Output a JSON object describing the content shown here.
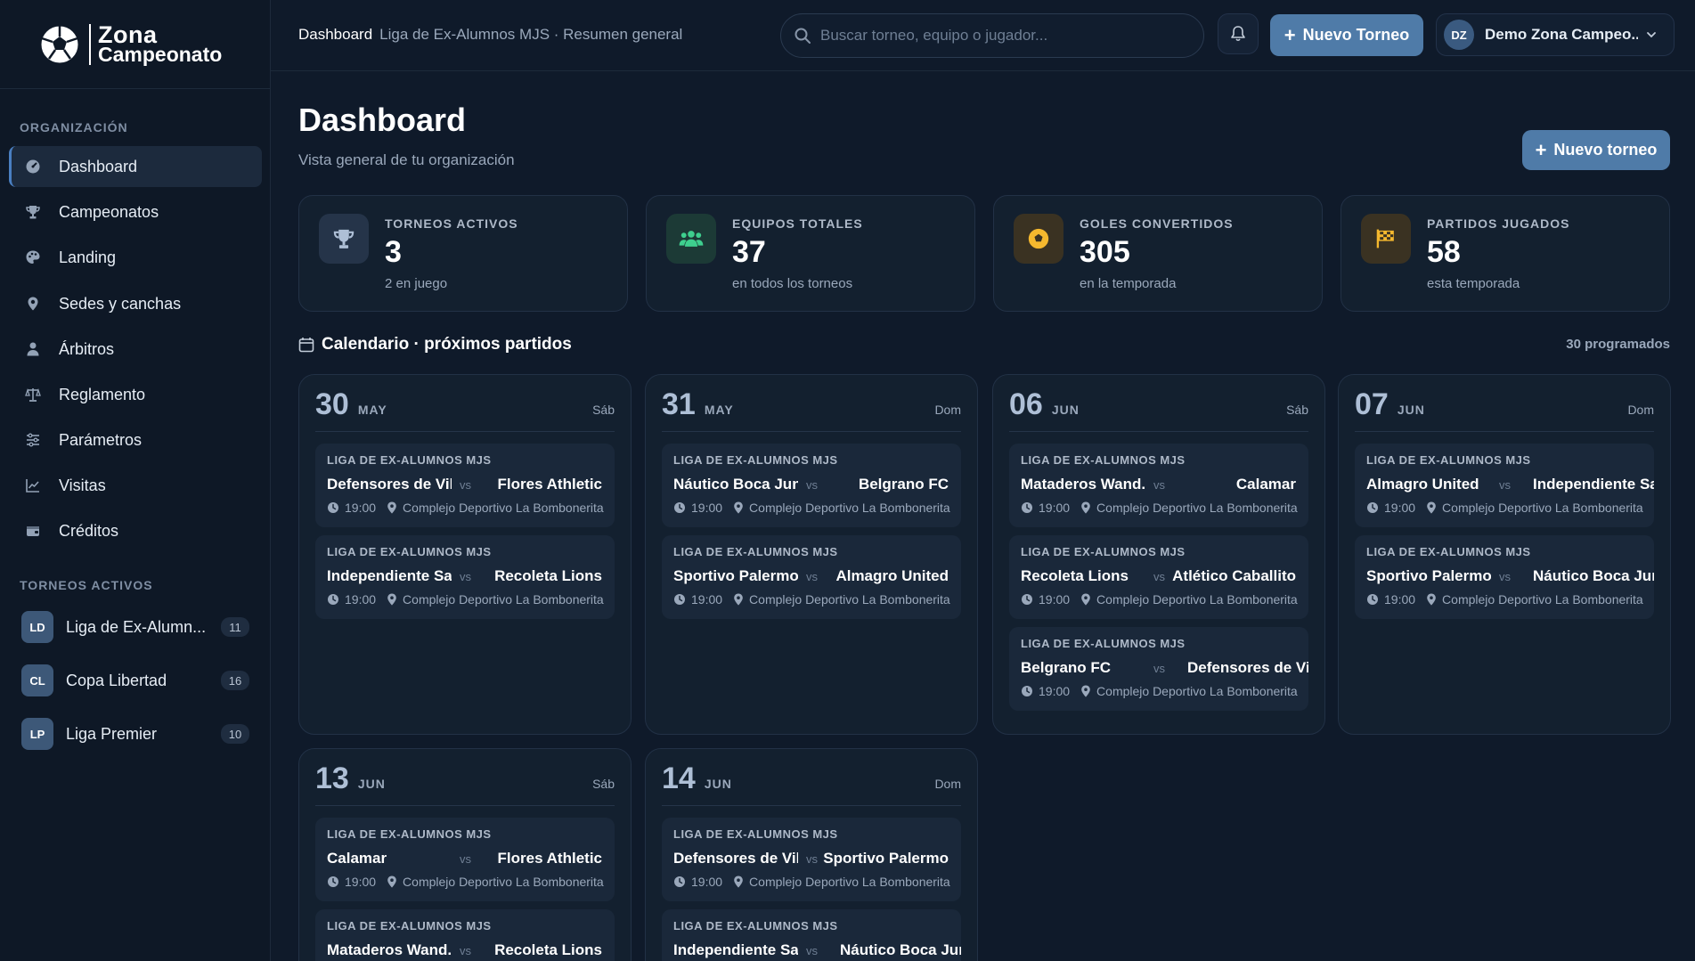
{
  "brand": {
    "line1": "Zona",
    "line2": "Campeonato"
  },
  "sidebar": {
    "org_section": "ORGANIZACIÓN",
    "items": [
      {
        "label": "Dashboard",
        "icon": "gauge-icon"
      },
      {
        "label": "Campeonatos",
        "icon": "trophy-icon"
      },
      {
        "label": "Landing",
        "icon": "palette-icon"
      },
      {
        "label": "Sedes y canchas",
        "icon": "map-pin-icon"
      },
      {
        "label": "Árbitros",
        "icon": "referee-icon"
      },
      {
        "label": "Reglamento",
        "icon": "scale-icon"
      },
      {
        "label": "Parámetros",
        "icon": "sliders-icon"
      },
      {
        "label": "Visitas",
        "icon": "chart-line-icon"
      },
      {
        "label": "Créditos",
        "icon": "wallet-icon"
      }
    ],
    "tournaments_section": "TORNEOS ACTIVOS",
    "tournaments": [
      {
        "initials": "LD",
        "name": "Liga de Ex-Alumn...",
        "count": "11"
      },
      {
        "initials": "CL",
        "name": "Copa Libertad",
        "count": "16"
      },
      {
        "initials": "LP",
        "name": "Liga Premier",
        "count": "10"
      }
    ]
  },
  "topbar": {
    "crumb_main": "Dashboard",
    "crumb_sub": "Liga de Ex-Alumnos MJS · Resumen general",
    "search_placeholder": "Buscar torneo, equipo o jugador...",
    "new_button": "Nuevo Torneo",
    "user_initials": "DZ",
    "user_name": "Demo Zona Campeo..."
  },
  "page": {
    "title": "Dashboard",
    "subtitle": "Vista general de tu organización",
    "new_button": "Nuevo torneo"
  },
  "stats": [
    {
      "label": "TORNEOS ACTIVOS",
      "value": "3",
      "sub": "2 en juego",
      "color": "#aebfd6",
      "bg": "#253449"
    },
    {
      "label": "EQUIPOS TOTALES",
      "value": "37",
      "sub": "en todos los torneos",
      "color": "#3ecf8e",
      "bg": "#1c3a36"
    },
    {
      "label": "GOLES CONVERTIDOS",
      "value": "305",
      "sub": "en la temporada",
      "color": "#f5b82e",
      "bg": "#3a3222"
    },
    {
      "label": "PARTIDOS JUGADOS",
      "value": "58",
      "sub": "esta temporada",
      "color": "#f5b82e",
      "bg": "#3a3222"
    }
  ],
  "calendar": {
    "title": "Calendario · próximos partidos",
    "count": "30 programados",
    "days": [
      {
        "num": "30",
        "month": "MAY",
        "dow": "Sáb",
        "matches": [
          {
            "league": "LIGA DE EX-ALUMNOS MJS",
            "home": "Defensores de Vil...",
            "vs": "vs",
            "away": "Flores Athletic",
            "time": "19:00",
            "venue": "Complejo Deportivo La Bombonerita"
          },
          {
            "league": "LIGA DE EX-ALUMNOS MJS",
            "home": "Independiente Sa...",
            "vs": "vs",
            "away": "Recoleta Lions",
            "time": "19:00",
            "venue": "Complejo Deportivo La Bombonerita"
          }
        ]
      },
      {
        "num": "31",
        "month": "MAY",
        "dow": "Dom",
        "matches": [
          {
            "league": "LIGA DE EX-ALUMNOS MJS",
            "home": "Náutico Boca Jun...",
            "vs": "vs",
            "away": "Belgrano FC",
            "time": "19:00",
            "venue": "Complejo Deportivo La Bombonerita"
          },
          {
            "league": "LIGA DE EX-ALUMNOS MJS",
            "home": "Sportivo Palermo",
            "vs": "vs",
            "away": "Almagro United",
            "time": "19:00",
            "venue": "Complejo Deportivo La Bombonerita"
          }
        ]
      },
      {
        "num": "06",
        "month": "JUN",
        "dow": "Sáb",
        "matches": [
          {
            "league": "LIGA DE EX-ALUMNOS MJS",
            "home": "Mataderos Wand...",
            "vs": "vs",
            "away": "Calamar",
            "time": "19:00",
            "venue": "Complejo Deportivo La Bombonerita"
          },
          {
            "league": "LIGA DE EX-ALUMNOS MJS",
            "home": "Recoleta Lions",
            "vs": "vs",
            "away": "Atlético Caballito",
            "time": "19:00",
            "venue": "Complejo Deportivo La Bombonerita"
          },
          {
            "league": "LIGA DE EX-ALUMNOS MJS",
            "home": "Belgrano FC",
            "vs": "vs",
            "away": "Defensores de Villa C",
            "time": "19:00",
            "venue": "Complejo Deportivo La Bombonerita"
          }
        ]
      },
      {
        "num": "07",
        "month": "JUN",
        "dow": "Dom",
        "matches": [
          {
            "league": "LIGA DE EX-ALUMNOS MJS",
            "home": "Almagro United",
            "vs": "vs",
            "away": "Independiente San Te",
            "time": "19:00",
            "venue": "Complejo Deportivo La Bombonerita"
          },
          {
            "league": "LIGA DE EX-ALUMNOS MJS",
            "home": "Sportivo Palermo",
            "vs": "vs",
            "away": "Náutico Boca Juniors",
            "time": "19:00",
            "venue": "Complejo Deportivo La Bombonerita"
          }
        ]
      },
      {
        "num": "13",
        "month": "JUN",
        "dow": "Sáb",
        "matches": [
          {
            "league": "LIGA DE EX-ALUMNOS MJS",
            "home": "Calamar",
            "vs": "vs",
            "away": "Flores Athletic",
            "time": "19:00",
            "venue": "Complejo Deportivo La Bombonerita"
          },
          {
            "league": "LIGA DE EX-ALUMNOS MJS",
            "home": "Mataderos Wand...",
            "vs": "vs",
            "away": "Recoleta Lions",
            "time": "19:00",
            "venue": "Complejo Deportivo La Bombonerita"
          }
        ]
      },
      {
        "num": "14",
        "month": "JUN",
        "dow": "Dom",
        "matches": [
          {
            "league": "LIGA DE EX-ALUMNOS MJS",
            "home": "Defensores de Vil...",
            "vs": "vs",
            "away": "Sportivo Palermo",
            "time": "19:00",
            "venue": "Complejo Deportivo La Bombonerita"
          },
          {
            "league": "LIGA DE EX-ALUMNOS MJS",
            "home": "Independiente Sa...",
            "vs": "vs",
            "away": "Náutico Boca Juniors",
            "time": "19:00",
            "venue": "Complejo Deportivo La Bombonerita"
          }
        ]
      }
    ]
  },
  "colors": {
    "accent": "#4f7ba8",
    "background": "#0f1a2a",
    "panel": "#13202f"
  }
}
